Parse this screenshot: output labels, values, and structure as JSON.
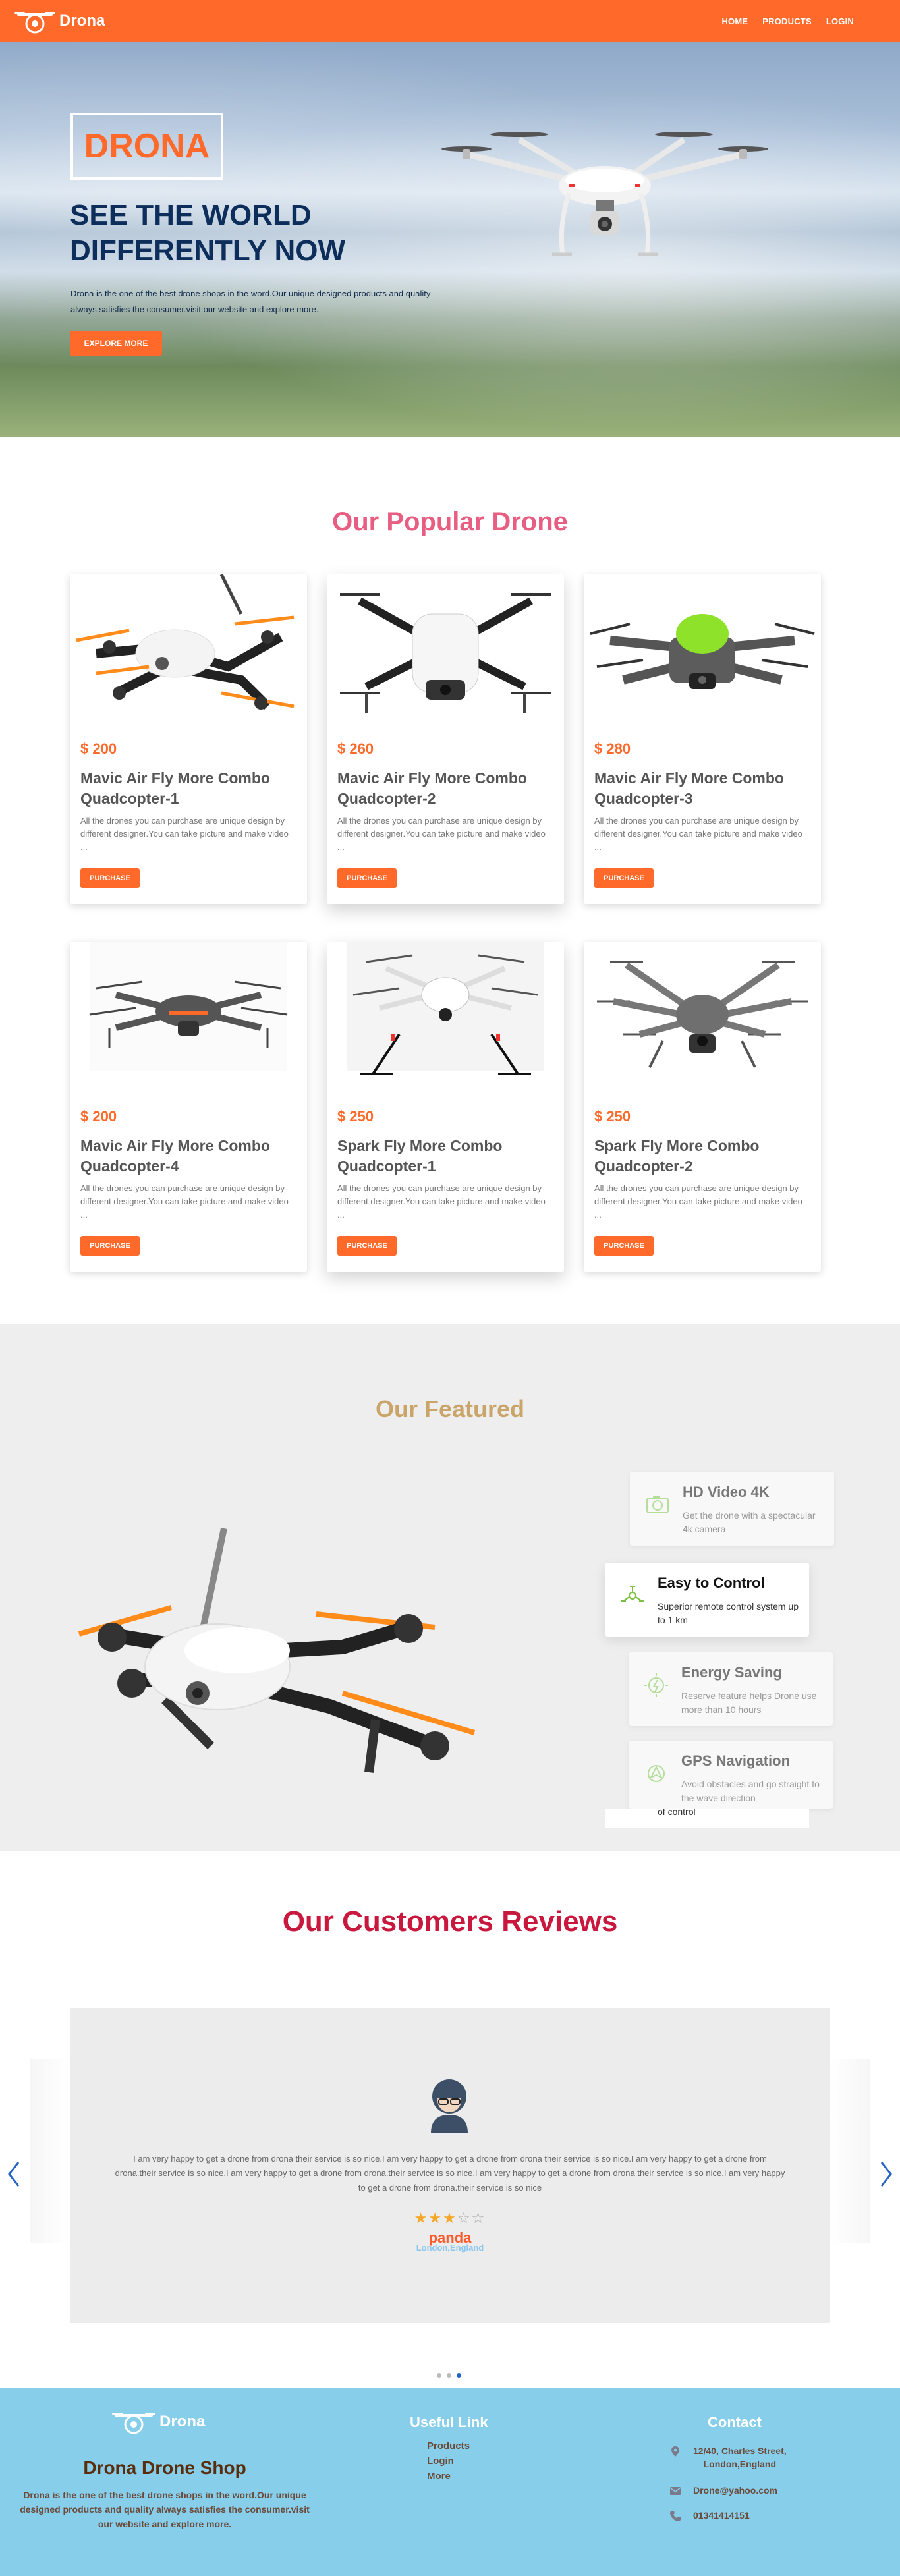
{
  "nav": {
    "brand": "Drona",
    "links": [
      "HOME",
      "PRODUCTS",
      "LOGIN"
    ]
  },
  "hero": {
    "brand": "DRONA",
    "headline_1": "SEE THE WORLD",
    "headline_2": "DIFFERENTLY NOW",
    "description": "Drona is the one of the best drone shops in the word.Our unique designed products and quality always satisfies the consumer.visit our website and explore more.",
    "button": "EXPLORE MORE"
  },
  "popular": {
    "title": "Our Popular Drone",
    "products": [
      {
        "price": "$ 200",
        "name": "Mavic Air Fly More Combo Quadcopter-1",
        "desc": "All the drones you can purchase are unique design by different designer.You can take picture and make video ...",
        "button": "PURCHASE"
      },
      {
        "price": "$ 260",
        "name": "Mavic Air Fly More Combo Quadcopter-2",
        "desc": "All the drones you can purchase are unique design by different designer.You can take picture and make video ...",
        "button": "PURCHASE"
      },
      {
        "price": "$ 280",
        "name": "Mavic Air Fly More Combo Quadcopter-3",
        "desc": "All the drones you can purchase are unique design by different designer.You can take picture and make video ...",
        "button": "PURCHASE"
      },
      {
        "price": "$ 200",
        "name": "Mavic Air Fly More Combo Quadcopter-4",
        "desc": "All the drones you can purchase are unique design by different designer.You can take picture and make video ...",
        "button": "PURCHASE"
      },
      {
        "price": "$ 250",
        "name": "Spark Fly More Combo Quadcopter-1",
        "desc": "All the drones you can purchase are unique design by different designer.You can take picture and make video ...",
        "button": "PURCHASE"
      },
      {
        "price": "$ 250",
        "name": "Spark Fly More Combo Quadcopter-2",
        "desc": "All the drones you can purchase are unique design by different designer.You can take picture and make video ...",
        "button": "PURCHASE"
      }
    ]
  },
  "featured": {
    "title": "Our Featured",
    "features": [
      {
        "title": "HD Video 4K",
        "desc": "Get the drone with a spectacular 4k camera",
        "icon": "camera-icon"
      },
      {
        "title": "Easy to Control",
        "desc": "Superior remote control system up to 1 km",
        "icon": "drone-control-icon"
      },
      {
        "title": "Energy Saving",
        "desc": "Reserve feature helps Drone use more than 10 hours",
        "icon": "energy-icon"
      },
      {
        "title": "GPS Navigation",
        "desc": "Avoid obstacles and go straight to the wave direction",
        "icon": "gps-icon"
      }
    ],
    "overflow_text": "of control"
  },
  "reviews": {
    "title": "Our Customers Reviews",
    "text": "I am very happy to get a drone from drona their service is so nice.I am very happy to get a drone from drona their service is so nice.I am very happy to get a drone from drona.their service is so nice.I am very happy to get a drone from drona.their service is so nice.I am very happy to get a drone from drona their service is so nice.I am very happy to get a drone from drona.their service is so nice",
    "rating": 3,
    "max_rating": 5,
    "name": "panda",
    "location": "London,England",
    "active_slide": 3,
    "slide_count": 3
  },
  "footer": {
    "brand": "Drona",
    "title": "Drona Drone Shop",
    "desc": "Drona is the one of the best drone shops in the word.Our unique designed products and quality always satisfies the consumer.visit our website and explore more.",
    "links_title": "Useful Link",
    "links": [
      "Products",
      "Login",
      "More"
    ],
    "contact_title": "Contact",
    "address_1": "12/40, Charles Street,",
    "address_2": "London,England",
    "email": "Drone@yahoo.com",
    "phone": "01341414151"
  },
  "colors": {
    "accent": "#ff6a2b",
    "footer": "#87ceeb",
    "featured_bg": "#eeeeee"
  }
}
